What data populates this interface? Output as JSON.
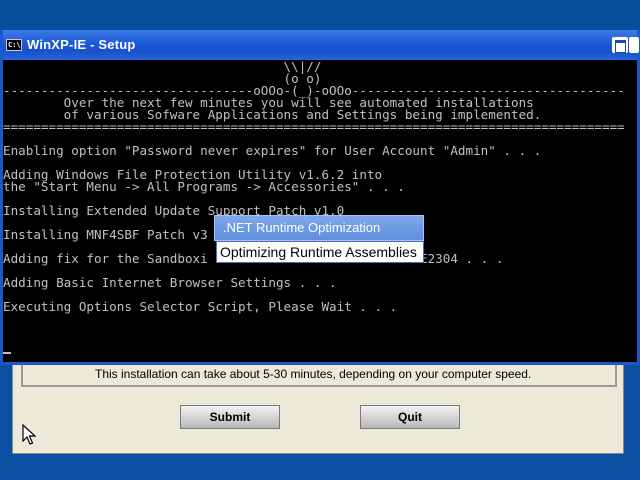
{
  "window": {
    "title": "WinXP-IE - Setup",
    "icon_text": "C:\\"
  },
  "console": {
    "lines": [
      "                                     \\\\|//",
      "                                     (o o)",
      "---------------------------------oOOo-(_)-oOOo------------------------------------",
      "        Over the next few minutes you will see automated installations",
      "        of various Sofware Applications and Settings being implemented.",
      "==================================================================================",
      "Enabling option \"Password never expires\" for User Account \"Admin\" . . .",
      "Adding Windows File Protection Utility v1.6.2 into",
      "the \"Start Menu -> All Programs -> Accessories\" . . .",
      "Installing Extended Update Support Patch v1.0",
      "Installing MNF4SBF Patch v3",
      "Adding fix for the Sandboxi                         SBIE2304 . . .",
      "Adding Basic Internet Browser Settings . . .",
      "Executing Options Selector Script, Please Wait . . ."
    ]
  },
  "popup": {
    "title": ".NET Runtime Optimization",
    "message": "Optimizing Runtime Assemblies"
  },
  "setup": {
    "info": "This installation can take about 5-30 minutes, depending on your computer speed.",
    "submit_label": "Submit",
    "quit_label": "Quit"
  }
}
